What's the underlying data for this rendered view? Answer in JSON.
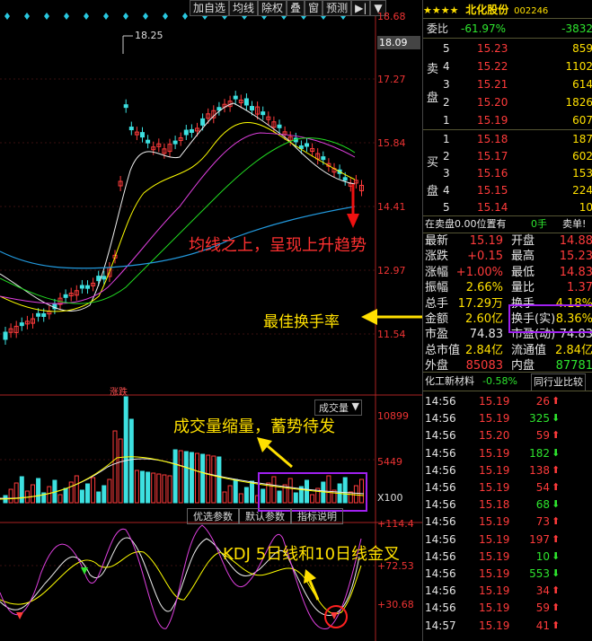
{
  "toolbar": {
    "items": [
      "加自选",
      "均线",
      "除权",
      "叠",
      "窗",
      "预测",
      "▶|",
      "▼"
    ]
  },
  "price_axis": {
    "labels": [
      "18.68",
      "17.27",
      "15.84",
      "14.41",
      "12.97",
      "11.54"
    ],
    "current": "18.09"
  },
  "chart_labels": {
    "high_marker": "18.25",
    "limit_tag": "涨跌"
  },
  "volume": {
    "title": "成交量",
    "axis": [
      "10899",
      "5449",
      "X100"
    ],
    "tabs": [
      "优选参数",
      "默认参数",
      "指标说明"
    ]
  },
  "kdj": {
    "axis": [
      "+114.4",
      "+72.53",
      "+30.68"
    ]
  },
  "annotations": {
    "trend": "均线之上，呈现上升趋势",
    "turnover": "最佳换手率",
    "volume": "成交量缩量，蓄势待发",
    "kdj": "KDJ 5日线和10日线金叉"
  },
  "quote": {
    "stars": "★★★★",
    "name": "北化股份",
    "code": "002246",
    "weibi_label": "委比",
    "weibi": "-61.97%",
    "weicha": "-3832",
    "sell_label_1": "卖",
    "sell_label_2": "盘",
    "buy_label_1": "买",
    "buy_label_2": "盘",
    "sell": [
      {
        "lv": "5",
        "price": "15.23",
        "vol": "859"
      },
      {
        "lv": "4",
        "price": "15.22",
        "vol": "1102"
      },
      {
        "lv": "3",
        "price": "15.21",
        "vol": "614"
      },
      {
        "lv": "2",
        "price": "15.20",
        "vol": "1826"
      },
      {
        "lv": "1",
        "price": "15.19",
        "vol": "607"
      }
    ],
    "buy": [
      {
        "lv": "1",
        "price": "15.18",
        "vol": "187"
      },
      {
        "lv": "2",
        "price": "15.17",
        "vol": "602"
      },
      {
        "lv": "3",
        "price": "15.16",
        "vol": "153"
      },
      {
        "lv": "4",
        "price": "15.15",
        "vol": "224"
      },
      {
        "lv": "5",
        "price": "15.14",
        "vol": "10"
      }
    ],
    "zaimai": "在卖盘0.00位置有",
    "zaimai_hands": "0手",
    "maiyi": "卖单!",
    "stats": [
      {
        "l1": "最新",
        "v1": "15.19",
        "l2": "开盘",
        "v2": "14.88",
        "c1": "red",
        "c2": "red"
      },
      {
        "l1": "涨跌",
        "v1": "+0.15",
        "l2": "最高",
        "v2": "15.23",
        "c1": "red",
        "c2": "red"
      },
      {
        "l1": "涨幅",
        "v1": "+1.00%",
        "l2": "最低",
        "v2": "14.83",
        "c1": "red",
        "c2": "red"
      },
      {
        "l1": "振幅",
        "v1": "2.66%",
        "l2": "量比",
        "v2": "1.37",
        "c1": "yellow",
        "c2": "red"
      },
      {
        "l1": "总手",
        "v1": "17.29万",
        "l2": "换手",
        "v2": "4.18%",
        "c1": "yellow",
        "c2": "yellow"
      },
      {
        "l1": "金额",
        "v1": "2.60亿",
        "l2": "换手(实)",
        "v2": "8.36%",
        "c1": "yellow",
        "c2": "yellow"
      },
      {
        "l1": "市盈",
        "v1": "74.83",
        "l2": "市盈(动)",
        "v2": "74.83",
        "c1": "white",
        "c2": "white"
      },
      {
        "l1": "总市值",
        "v1": "2.84亿",
        "l2": "流通值",
        "v2": "2.84亿",
        "c1": "yellow",
        "c2": "yellow"
      },
      {
        "l1": "外盘",
        "v1": "85083",
        "l2": "内盘",
        "v2": "87781",
        "c1": "red",
        "c2": "green"
      }
    ],
    "industry_label": "化工新材料",
    "industry_change": "-0.58%",
    "industry_compare": "同行业比较",
    "ticks": [
      {
        "t": "14:56",
        "p": "15.19",
        "v": "26",
        "d": "up"
      },
      {
        "t": "14:56",
        "p": "15.19",
        "v": "325",
        "d": "down"
      },
      {
        "t": "14:56",
        "p": "15.20",
        "v": "59",
        "d": "up"
      },
      {
        "t": "14:56",
        "p": "15.19",
        "v": "182",
        "d": "down"
      },
      {
        "t": "14:56",
        "p": "15.19",
        "v": "138",
        "d": "up"
      },
      {
        "t": "14:56",
        "p": "15.19",
        "v": "54",
        "d": "up"
      },
      {
        "t": "14:56",
        "p": "15.18",
        "v": "68",
        "d": "down"
      },
      {
        "t": "14:56",
        "p": "15.19",
        "v": "73",
        "d": "up"
      },
      {
        "t": "14:56",
        "p": "15.19",
        "v": "197",
        "d": "up"
      },
      {
        "t": "14:56",
        "p": "15.19",
        "v": "10",
        "d": "down"
      },
      {
        "t": "14:56",
        "p": "15.19",
        "v": "553",
        "d": "down"
      },
      {
        "t": "14:56",
        "p": "15.19",
        "v": "34",
        "d": "up"
      },
      {
        "t": "14:56",
        "p": "15.19",
        "v": "59",
        "d": "up"
      },
      {
        "t": "14:57",
        "p": "15.19",
        "v": "41",
        "d": "up"
      }
    ]
  },
  "colors": {
    "up": "#ff3b3b",
    "down": "#2ee52e",
    "accent": "#ffe000",
    "box": "#a020f0"
  }
}
